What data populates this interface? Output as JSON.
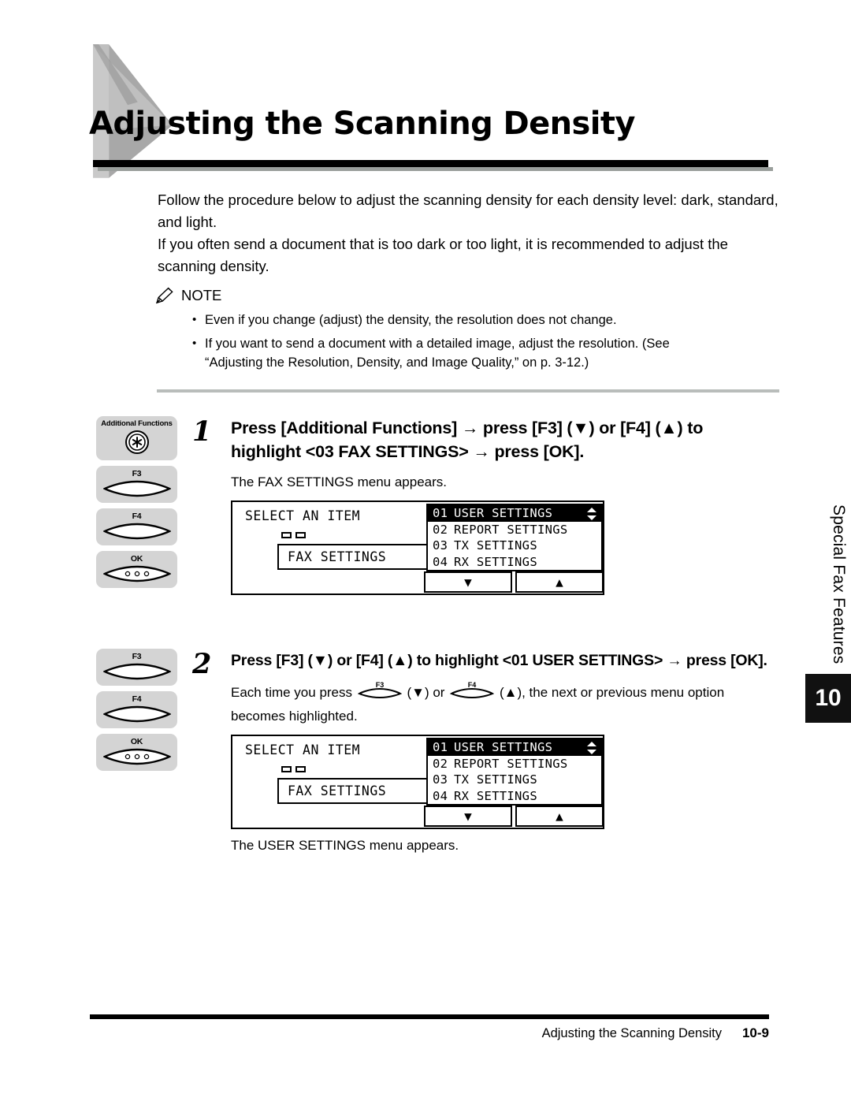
{
  "header": {
    "title": "Adjusting the Scanning Density"
  },
  "intro": {
    "paragraph1": "Follow the procedure below to adjust the scanning density for each density level: dark, standard, and light.",
    "paragraph2": "If you often send a document that is too dark or too light, it is recommended to adjust the scanning density."
  },
  "note": {
    "icon": "pencil-icon",
    "label": "NOTE",
    "items": [
      "Even if you change (adjust) the density, the resolution does not change.",
      "If you want to send a document with a detailed image, adjust the resolution. (See",
      "“Adjusting the Resolution, Density, and Image Quality,” on p. 3-12.)"
    ]
  },
  "step1": {
    "number": "1",
    "heading": "Press [Additional Functions] → press [F3] (▼) or [F4] (▲) to highlight <03 FAX SETTINGS> → press [OK].",
    "body": "The FAX SETTINGS menu appears.",
    "keys": [
      {
        "label": "Additional Functions",
        "icon": "asterisk-round-key"
      },
      {
        "label": "F3",
        "icon": "oval-key"
      },
      {
        "label": "F4",
        "icon": "oval-key"
      },
      {
        "label": "OK",
        "icon": "oval-key-dots"
      }
    ]
  },
  "step2": {
    "number": "2",
    "heading": "Press [F3] (▼) or [F4] (▲) to highlight <01 USER SETTINGS> → press [OK].",
    "body_part1": "Each time you press",
    "body_part2": "(▼) or",
    "body_part3": "(▲), the next or previous menu option becomes highlighted.",
    "inline_key1": "F3",
    "inline_key2": "F4",
    "after_lcd": "The USER SETTINGS menu appears.",
    "keys": [
      {
        "label": "F3",
        "icon": "oval-key"
      },
      {
        "label": "F4",
        "icon": "oval-key"
      },
      {
        "label": "OK",
        "icon": "oval-key-dots"
      }
    ]
  },
  "lcd": {
    "title": "SELECT AN ITEM",
    "selected_box": "FAX SETTINGS",
    "menu": [
      {
        "num": "01",
        "text": "USER SETTINGS",
        "highlighted": true
      },
      {
        "num": "02",
        "text": "REPORT SETTINGS",
        "highlighted": false
      },
      {
        "num": "03",
        "text": "TX SETTINGS",
        "highlighted": false
      },
      {
        "num": "04",
        "text": "RX SETTINGS",
        "highlighted": false
      }
    ],
    "button_down": "▼",
    "button_up": "▲",
    "scroll_indicator": "up-down-arrow-icon"
  },
  "sidebar": {
    "section_label": "Special Fax Features",
    "chapter_number": "10"
  },
  "footer": {
    "title": "Adjusting the Scanning Density",
    "page": "10-9"
  },
  "colors": {
    "accent_gray": "#c9c9c9",
    "bar_black": "#000000",
    "bar_gray": "#9a9f9c",
    "key_face": "#d4d4d4",
    "separator": "#b9bdbb"
  }
}
